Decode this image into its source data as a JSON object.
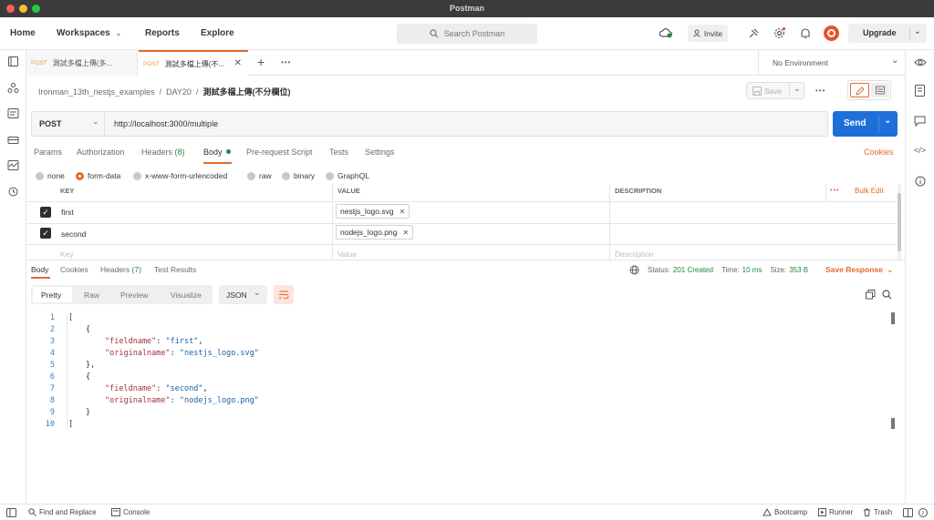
{
  "window": {
    "title": "Postman"
  },
  "header": {
    "home": "Home",
    "workspaces": "Workspaces",
    "reports": "Reports",
    "explore": "Explore",
    "search_placeholder": "Search Postman",
    "invite": "Invite",
    "upgrade": "Upgrade"
  },
  "tabs": [
    {
      "method": "POST",
      "label": "測試多檔上傳(多..."
    },
    {
      "method": "POST",
      "label": "測試多檔上傳(不..."
    }
  ],
  "environment": "No Environment",
  "breadcrumb": {
    "collection": "Ironman_13th_nestjs_examples",
    "folder": "DAY20",
    "request": "測試多檔上傳(不分欄位)"
  },
  "save_label": "Save",
  "request": {
    "method": "POST",
    "url": "http://localhost:3000/multiple",
    "send_label": "Send"
  },
  "request_tabs": {
    "params": "Params",
    "authorization": "Authorization",
    "headers": "Headers",
    "headers_count": "(8)",
    "body": "Body",
    "pre_request": "Pre-request Script",
    "tests": "Tests",
    "settings": "Settings",
    "cookies": "Cookies"
  },
  "body_types": {
    "none": "none",
    "form_data": "form-data",
    "urlencoded": "x-www-form-urlencoded",
    "raw": "raw",
    "binary": "binary",
    "graphql": "GraphQL"
  },
  "form_table": {
    "col_key": "KEY",
    "col_value": "VALUE",
    "col_description": "DESCRIPTION",
    "more": "•••",
    "bulk_edit": "Bulk Edit",
    "rows": [
      {
        "key": "first",
        "value": "nestjs_logo.svg"
      },
      {
        "key": "second",
        "value": "nodejs_logo.png"
      }
    ],
    "placeholder_key": "Key",
    "placeholder_value": "Value",
    "placeholder_description": "Description"
  },
  "response_tabs": {
    "body": "Body",
    "cookies": "Cookies",
    "headers": "Headers",
    "headers_count": "(7)",
    "test_results": "Test Results"
  },
  "response_meta": {
    "status_label": "Status:",
    "status_value": "201 Created",
    "time_label": "Time:",
    "time_value": "10 ms",
    "size_label": "Size:",
    "size_value": "353 B",
    "save_response": "Save Response"
  },
  "view_modes": {
    "pretty": "Pretty",
    "raw": "Raw",
    "preview": "Preview",
    "visualize": "Visualize",
    "format": "JSON"
  },
  "code": {
    "line_numbers": [
      "1",
      "2",
      "3",
      "4",
      "5",
      "6",
      "7",
      "8",
      "9",
      "10"
    ],
    "open_bracket": "[",
    "open_brace": "{",
    "close_brace": "},",
    "close_brace_last": "}",
    "close_bracket": "]",
    "key_fieldname": "\"fieldname\"",
    "key_originalname": "\"originalname\"",
    "v1_fieldname": "\"first\"",
    "v1_originalname": "\"nestjs_logo.svg\"",
    "v2_fieldname": "\"second\"",
    "v2_originalname": "\"nodejs_logo.png\"",
    "colon": ": ",
    "comma": ","
  },
  "statusbar": {
    "find_replace": "Find and Replace",
    "console": "Console",
    "bootcamp": "Bootcamp",
    "runner": "Runner",
    "trash": "Trash"
  },
  "colors": {
    "send": "#1f6fd9",
    "accent_orange": "#e56a2b",
    "status_green": "#1e8a3e",
    "method_post": "#e79b4a"
  }
}
